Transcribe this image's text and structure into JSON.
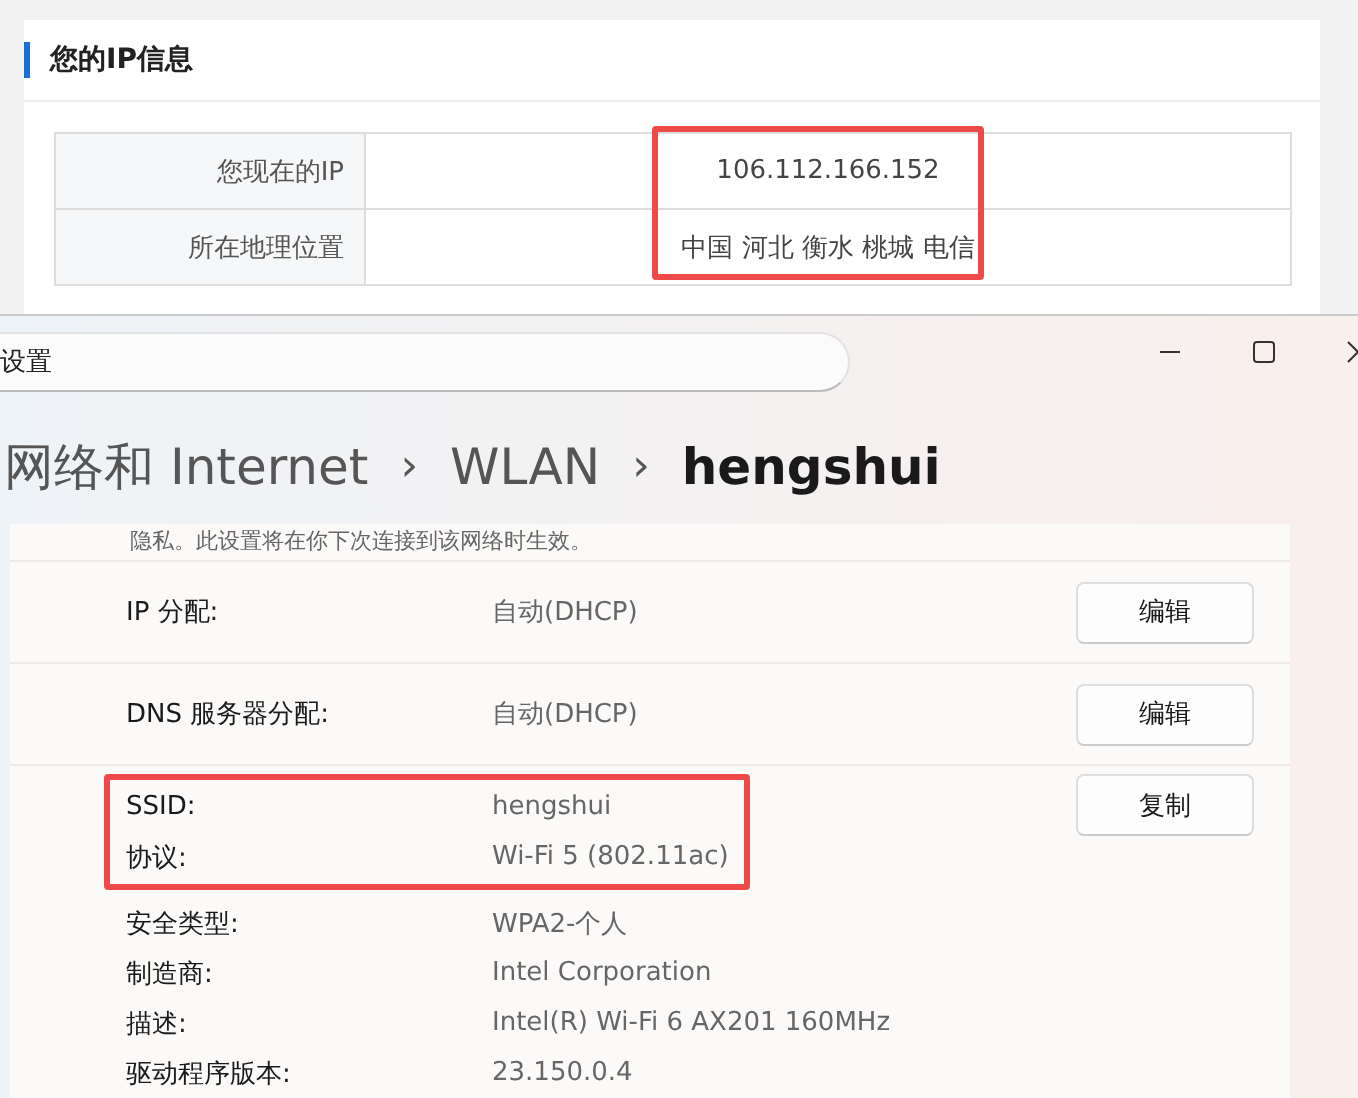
{
  "ip_panel": {
    "title": "您的IP信息",
    "rows": [
      {
        "label": "您现在的IP",
        "value": "106.112.166.152",
        "highlighted": true
      },
      {
        "label": "所在地理位置",
        "value": "中国 河北 衡水 桃城 电信",
        "highlighted": true
      }
    ]
  },
  "settings_window": {
    "search": {
      "value": "设置"
    },
    "breadcrumb": [
      {
        "label": "网络和 Internet",
        "current": false
      },
      {
        "label": "WLAN",
        "current": false
      },
      {
        "label": "hengshui",
        "current": true
      }
    ],
    "separator": "›",
    "note": "隐私。此设置将在你下次连接到该网络时生效。",
    "sections": [
      {
        "highlighted": false,
        "button": "编辑",
        "rows": [
          {
            "label": "IP 分配:",
            "value": "自动(DHCP)"
          }
        ]
      },
      {
        "highlighted": false,
        "button": "编辑",
        "rows": [
          {
            "label": "DNS 服务器分配:",
            "value": "自动(DHCP)"
          }
        ]
      },
      {
        "highlighted": true,
        "button": "复制",
        "rows": [
          {
            "label": "SSID:",
            "value": "hengshui"
          },
          {
            "label": "协议:",
            "value": "Wi-Fi 5 (802.11ac)"
          }
        ]
      },
      {
        "highlighted": false,
        "rows": [
          {
            "label": "安全类型:",
            "value": "WPA2-个人"
          },
          {
            "label": "制造商:",
            "value": "Intel Corporation"
          },
          {
            "label": "描述:",
            "value": "Intel(R) Wi-Fi 6 AX201 160MHz"
          },
          {
            "label": "驱动程序版本:",
            "value": "23.150.0.4"
          }
        ]
      }
    ]
  }
}
